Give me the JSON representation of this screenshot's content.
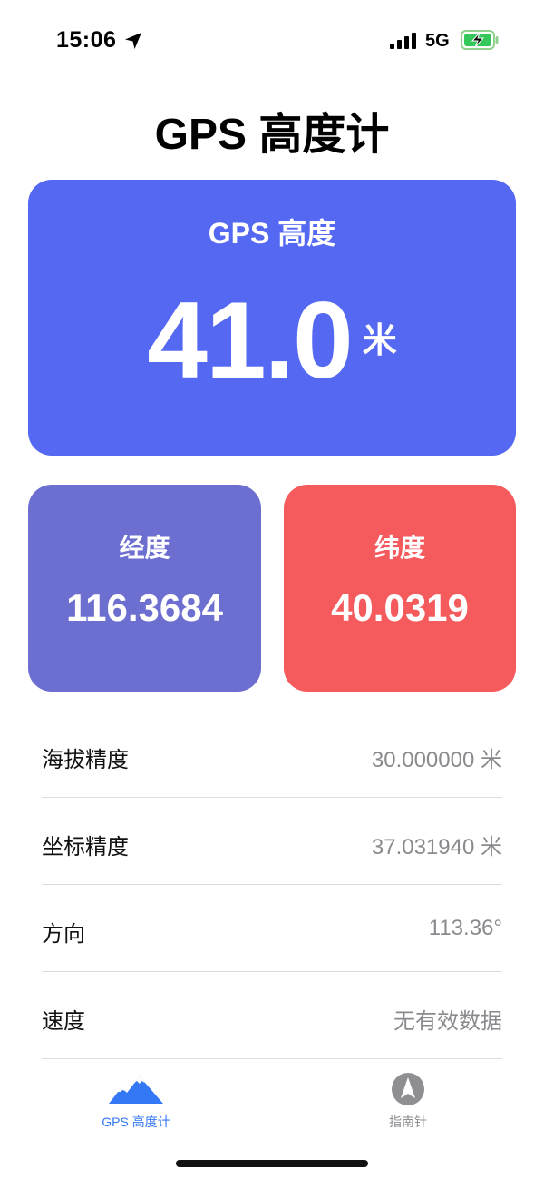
{
  "status_bar": {
    "time": "15:06",
    "network": "5G"
  },
  "header": {
    "title": "GPS 高度计"
  },
  "altitude_card": {
    "label": "GPS 高度",
    "value": "41.0",
    "unit": "米",
    "color": "#5568f1"
  },
  "longitude_card": {
    "label": "经度",
    "value": "116.3684",
    "color": "#6c6fd0"
  },
  "latitude_card": {
    "label": "纬度",
    "value": "40.0319",
    "color": "#f55a5c"
  },
  "details": [
    {
      "label": "海拔精度",
      "value": "30.000000 米"
    },
    {
      "label": "坐标精度",
      "value": "37.031940 米"
    },
    {
      "label": "方向",
      "value": "113.36°"
    },
    {
      "label": "速度",
      "value": "无有效数据"
    }
  ],
  "tab_bar": {
    "tabs": [
      {
        "label": "GPS 高度计",
        "icon": "mountain-icon",
        "selected": true
      },
      {
        "label": "指南针",
        "icon": "compass-icon",
        "selected": false
      }
    ]
  }
}
